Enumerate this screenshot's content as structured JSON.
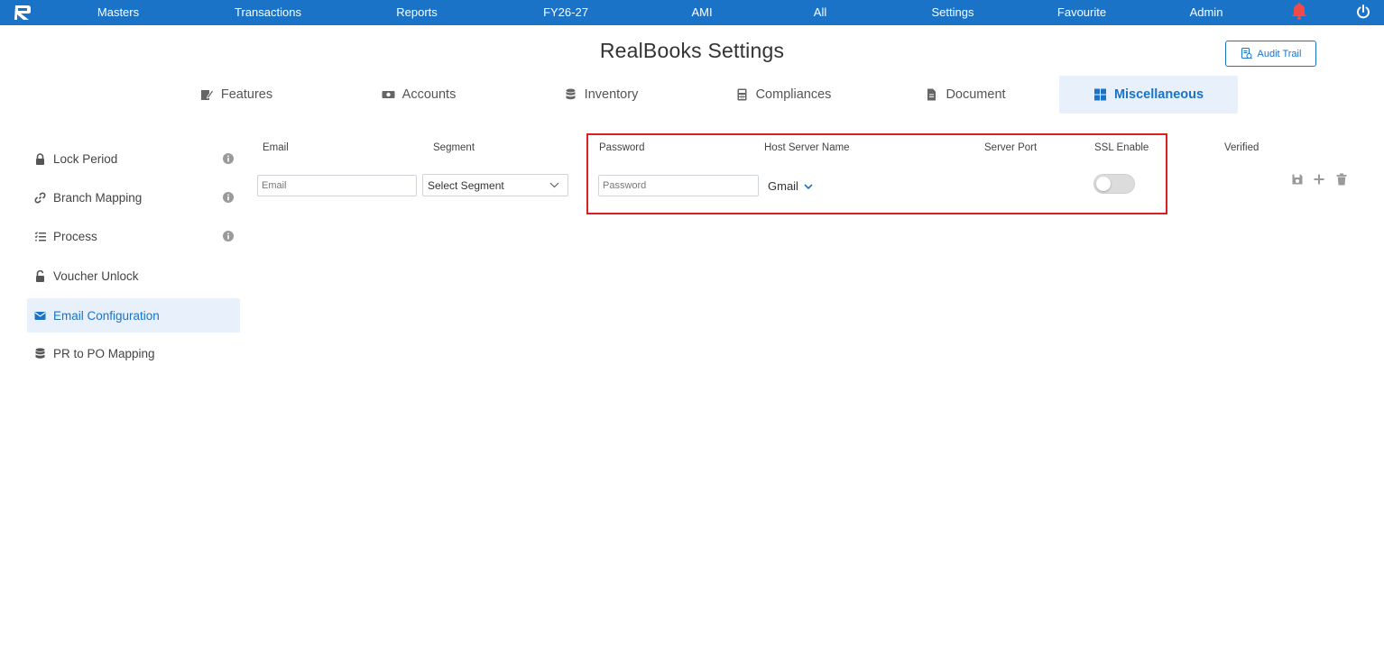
{
  "topnav": {
    "items": [
      "Masters",
      "Transactions",
      "Reports",
      "FY26-27",
      "AMI",
      "All",
      "Settings",
      "Favourite",
      "Admin"
    ]
  },
  "page": {
    "title": "RealBooks Settings",
    "audit_trail_label": "Audit Trail"
  },
  "tabs": [
    {
      "label": "Features",
      "icon": "edit-icon"
    },
    {
      "label": "Accounts",
      "icon": "money-icon"
    },
    {
      "label": "Inventory",
      "icon": "database-icon"
    },
    {
      "label": "Compliances",
      "icon": "calculator-icon"
    },
    {
      "label": "Document",
      "icon": "file-icon"
    },
    {
      "label": "Miscellaneous",
      "icon": "grid-icon",
      "active": true
    }
  ],
  "sidebar": {
    "items": [
      {
        "label": "Lock Period",
        "icon": "lock-icon",
        "info": true
      },
      {
        "label": "Branch Mapping",
        "icon": "link-icon",
        "info": true
      },
      {
        "label": "Process",
        "icon": "list-icon",
        "info": true
      },
      {
        "label": "Voucher Unlock",
        "icon": "unlock-icon"
      },
      {
        "label": "Email Configuration",
        "icon": "envelope-icon",
        "active": true
      },
      {
        "label": "PR to PO Mapping",
        "icon": "database-icon"
      }
    ]
  },
  "email_config": {
    "columns": [
      "Email",
      "Segment",
      "Password",
      "Host Server Name",
      "Server Port",
      "SSL Enable",
      "Verified"
    ],
    "email_placeholder": "Email",
    "segment_value": "Select Segment",
    "password_placeholder": "Password",
    "host_server_value": "Gmail",
    "ssl_enabled": false
  },
  "colors": {
    "primary": "#1a73c7",
    "active_bg": "#e8f1fb",
    "highlight_border": "#d92027",
    "bell": "#f04a4a"
  }
}
